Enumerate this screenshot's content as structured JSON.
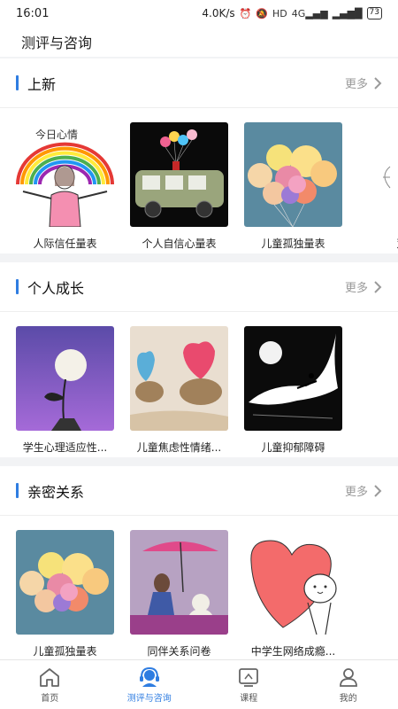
{
  "status_bar": {
    "time": "16:01",
    "network_speed": "4.0K/s",
    "hd_badge": "HD",
    "signal": "4G",
    "battery": "73"
  },
  "header": {
    "title": "测评与咨询"
  },
  "sections": [
    {
      "title": "上新",
      "more": "更多",
      "items": [
        {
          "label": "人际信任量表",
          "image_caption": "今日心情"
        },
        {
          "label": "个人自信心量表"
        },
        {
          "label": "儿童孤独量表"
        },
        {
          "label": "双相"
        }
      ]
    },
    {
      "title": "个人成长",
      "more": "更多",
      "items": [
        {
          "label": "学生心理适应性..."
        },
        {
          "label": "儿童焦虑性情绪..."
        },
        {
          "label": "儿童抑郁障碍"
        }
      ]
    },
    {
      "title": "亲密关系",
      "more": "更多",
      "items": [
        {
          "label": "儿童孤独量表"
        },
        {
          "label": "同伴关系问卷"
        },
        {
          "label": "中学生网络成瘾..."
        }
      ]
    }
  ],
  "tabs": [
    {
      "label": "首页",
      "icon": "home-icon",
      "active": false
    },
    {
      "label": "测评与咨询",
      "icon": "headset-icon",
      "active": true
    },
    {
      "label": "课程",
      "icon": "course-icon",
      "active": false
    },
    {
      "label": "我的",
      "icon": "profile-icon",
      "active": false
    }
  ],
  "colors": {
    "accent": "#2f7de1",
    "muted": "#9a9a9a",
    "background": "#f2f3f5"
  }
}
